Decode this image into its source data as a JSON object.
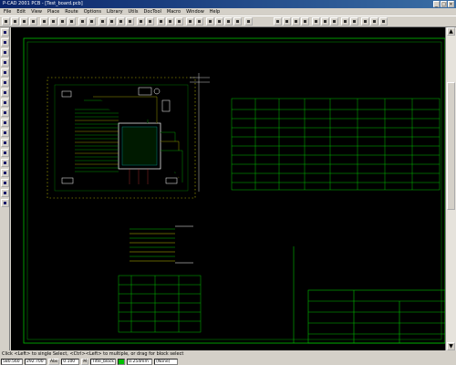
{
  "window": {
    "title": "P-CAD 2001 PCB - [Test_board.pcb]"
  },
  "menu": [
    "File",
    "Edit",
    "View",
    "Place",
    "Route",
    "Options",
    "Library",
    "Utils",
    "DocTool",
    "Macro",
    "Window",
    "Help"
  ],
  "status": {
    "hint": "Click <Left> to single Select, <Ctrl><Left> to multiple, or drag for block select"
  },
  "bottom": {
    "x_coord": "580.560",
    "y_coord": "292.700",
    "abs_label": "Abs",
    "grid": "0.100",
    "layer_m": "M",
    "layer": "Title_block",
    "width": "0.254mm",
    "net": "(None)"
  },
  "colors": {
    "trace": "#00c000",
    "component": "#ffffff",
    "copper": "#c0c000",
    "bg": "#000000"
  },
  "icons": [
    "select-icon",
    "route-icon",
    "zoom-icon",
    "pad-icon",
    "via-icon",
    "text-icon",
    "line-icon",
    "arc-icon",
    "polygon-icon",
    "fill-icon",
    "component-icon",
    "dimension-icon"
  ]
}
